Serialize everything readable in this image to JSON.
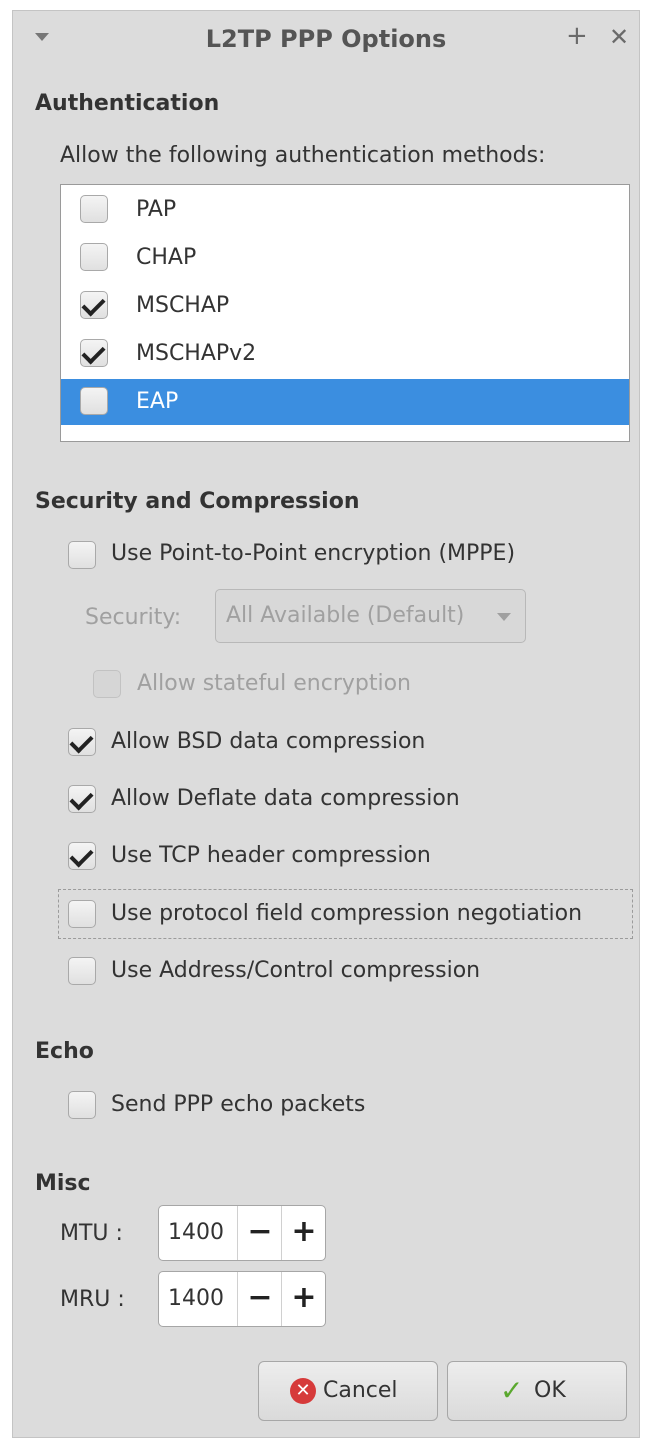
{
  "window": {
    "title": "L2TP PPP Options",
    "add_glyph": "+",
    "close_glyph": "✕"
  },
  "auth": {
    "heading": "Authentication",
    "subtitle": "Allow the following authentication methods:",
    "methods": [
      {
        "label": "PAP",
        "checked": false
      },
      {
        "label": "CHAP",
        "checked": false
      },
      {
        "label": "MSCHAP",
        "checked": true
      },
      {
        "label": "MSCHAPv2",
        "checked": true
      },
      {
        "label": "EAP",
        "checked": false,
        "selected": true
      }
    ],
    "selected_color": "#3b8ee0"
  },
  "security": {
    "heading": "Security and Compression",
    "mppe": {
      "label": "Use Point-to-Point encryption (MPPE)",
      "checked": false
    },
    "security_label": "Security:",
    "security_value": "All Available (Default)",
    "stateful": {
      "label": "Allow stateful encryption",
      "checked": false
    },
    "bsd": {
      "label": "Allow BSD data compression",
      "checked": true
    },
    "deflate": {
      "label": "Allow Deflate data compression",
      "checked": true
    },
    "tcp": {
      "label": "Use TCP header compression",
      "checked": true
    },
    "protocol_field": {
      "label": "Use protocol field compression negotiation",
      "checked": false
    },
    "address_control": {
      "label": "Use Address/Control compression",
      "checked": false
    }
  },
  "echo": {
    "heading": "Echo",
    "send": {
      "label": "Send PPP echo packets",
      "checked": false
    }
  },
  "misc": {
    "heading": "Misc",
    "mtu_label": "MTU :",
    "mtu_value": "1400",
    "mru_label": "MRU :",
    "mru_value": "1400",
    "minus": "−",
    "plus": "+"
  },
  "buttons": {
    "cancel": "Cancel",
    "ok": "OK",
    "cancel_icon": "✕",
    "ok_icon": "✓"
  }
}
